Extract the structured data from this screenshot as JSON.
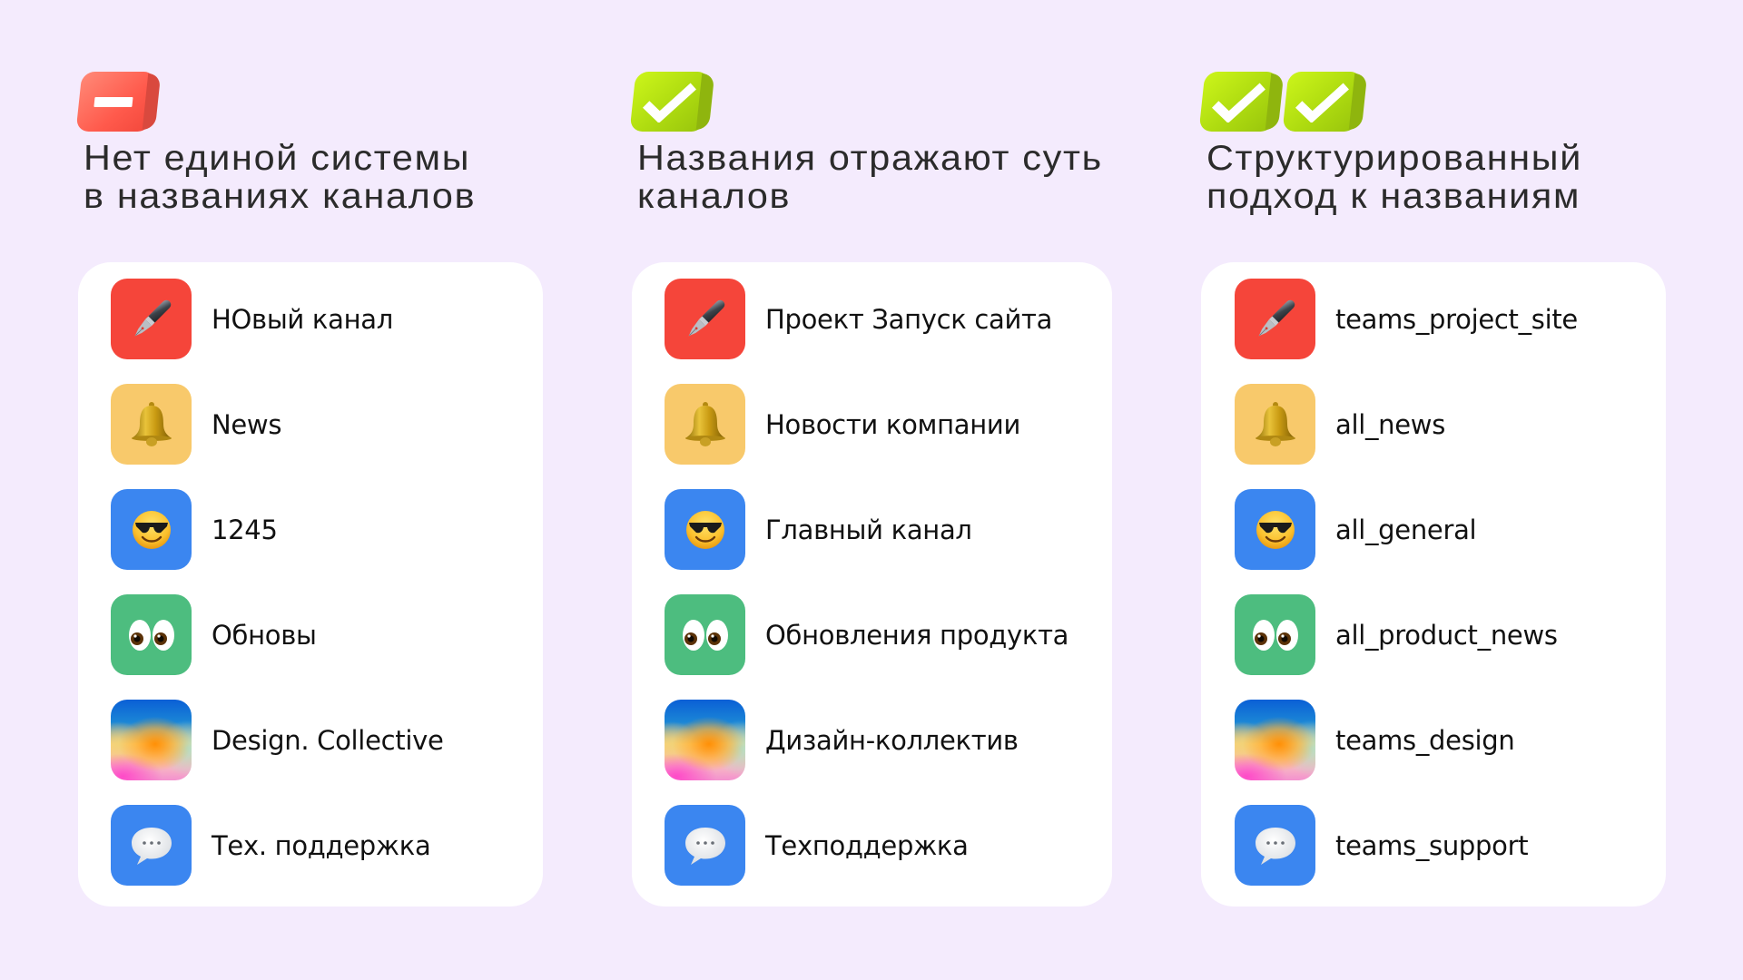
{
  "columns": [
    {
      "id": "bad",
      "badges": [
        "minus"
      ],
      "title": "Нет единой системы\nв названиях каналов",
      "channels": [
        {
          "icon": "fountain-pen-icon",
          "icon_bg": "#f5453a",
          "name": "НОвый канал"
        },
        {
          "icon": "bell-icon",
          "icon_bg": "#f8c96b",
          "name": "News"
        },
        {
          "icon": "sunglasses-smiley-icon",
          "icon_bg": "#3b86f0",
          "name": "1245"
        },
        {
          "icon": "eyes-icon",
          "icon_bg": "#4dbd7f",
          "name": "Обновы"
        },
        {
          "icon": "gradient-icon",
          "icon_bg": "gradient",
          "name": "Design. Collective"
        },
        {
          "icon": "speech-bubble-icon",
          "icon_bg": "#3b86f0",
          "name": "Тех. поддержка"
        }
      ]
    },
    {
      "id": "good",
      "badges": [
        "check"
      ],
      "title": "Названия отражают суть\nканалов",
      "channels": [
        {
          "icon": "fountain-pen-icon",
          "icon_bg": "#f5453a",
          "name": "Проект Запуск сайта"
        },
        {
          "icon": "bell-icon",
          "icon_bg": "#f8c96b",
          "name": "Новости компании"
        },
        {
          "icon": "sunglasses-smiley-icon",
          "icon_bg": "#3b86f0",
          "name": "Главный канал"
        },
        {
          "icon": "eyes-icon",
          "icon_bg": "#4dbd7f",
          "name": "Обновления продукта"
        },
        {
          "icon": "gradient-icon",
          "icon_bg": "gradient",
          "name": "Дизайн-коллектив"
        },
        {
          "icon": "speech-bubble-icon",
          "icon_bg": "#3b86f0",
          "name": "Техподдержка"
        }
      ]
    },
    {
      "id": "best",
      "badges": [
        "check",
        "check"
      ],
      "title": "Структурированный\nподход к названиям",
      "channels": [
        {
          "icon": "fountain-pen-icon",
          "icon_bg": "#f5453a",
          "name": "teams_project_site"
        },
        {
          "icon": "bell-icon",
          "icon_bg": "#f8c96b",
          "name": "all_news"
        },
        {
          "icon": "sunglasses-smiley-icon",
          "icon_bg": "#3b86f0",
          "name": "all_general"
        },
        {
          "icon": "eyes-icon",
          "icon_bg": "#4dbd7f",
          "name": "all_product_news"
        },
        {
          "icon": "gradient-icon",
          "icon_bg": "gradient",
          "name": "teams_design"
        },
        {
          "icon": "speech-bubble-icon",
          "icon_bg": "#3b86f0",
          "name": "teams_support"
        }
      ]
    }
  ],
  "colors": {
    "background": "#f4ebfd",
    "card": "#ffffff",
    "title_text": "#2b2b2b",
    "label_text": "#111111",
    "badge_bad": "#ff5a4c",
    "badge_good": "#b5e012"
  }
}
